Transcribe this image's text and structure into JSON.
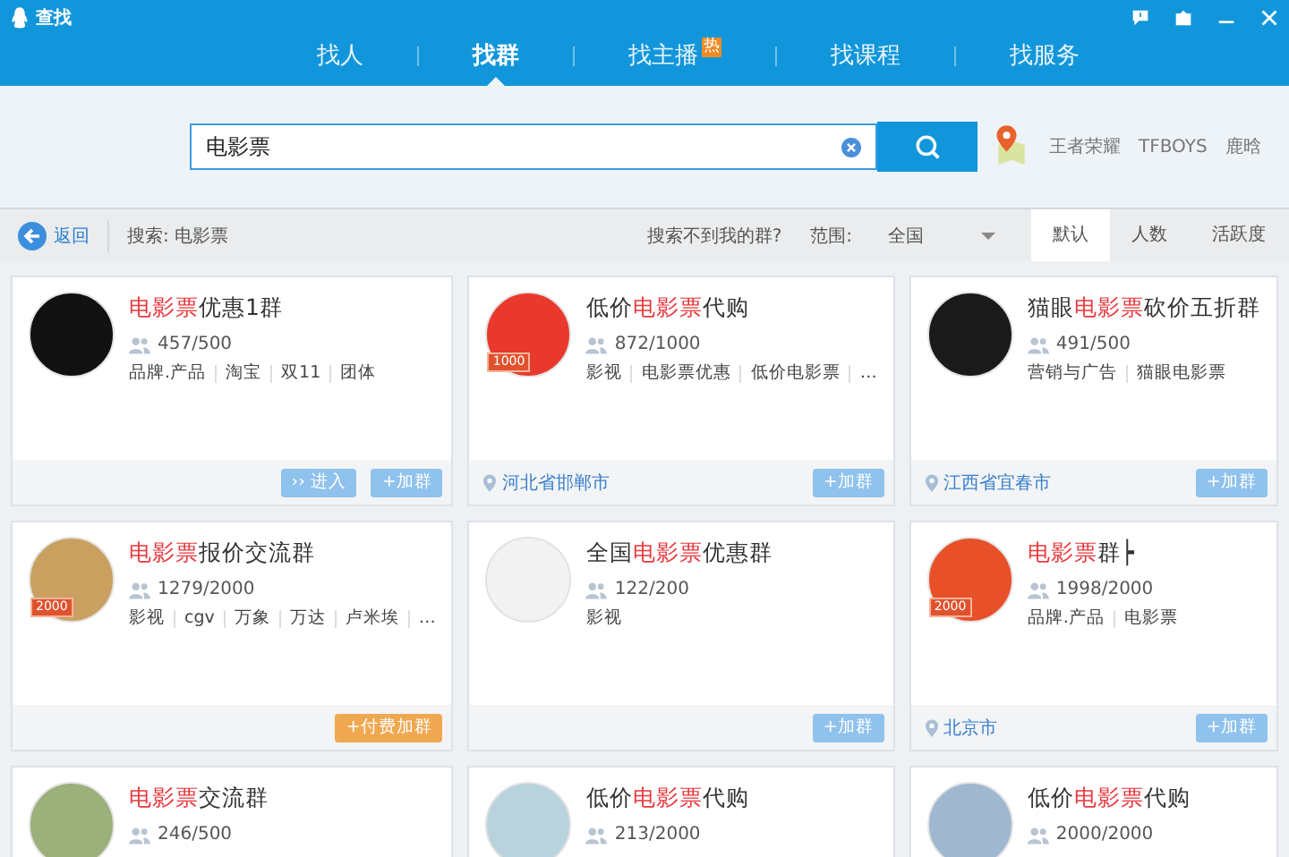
{
  "window": {
    "title": "查找"
  },
  "tabs": [
    {
      "label": "找人",
      "selected": false
    },
    {
      "label": "找群",
      "selected": true
    },
    {
      "label": "找主播",
      "selected": false,
      "badge": "热"
    },
    {
      "label": "找课程",
      "selected": false
    },
    {
      "label": "找服务",
      "selected": false
    }
  ],
  "search": {
    "value": "电影票",
    "hot_words": [
      "王者荣耀",
      "TFBOYS",
      "鹿晗"
    ]
  },
  "toolbar": {
    "back": "返回",
    "query": "搜索: 电影票",
    "help_link": "搜索不到我的群?",
    "range_label": "范围:",
    "range_value": "全国",
    "sorts": [
      {
        "label": "默认",
        "selected": true
      },
      {
        "label": "人数",
        "selected": false
      },
      {
        "label": "活跃度",
        "selected": false
      }
    ]
  },
  "groups": [
    {
      "name": [
        {
          "text": "电影票",
          "highlight": true
        },
        {
          "text": "优惠1群",
          "highlight": false
        }
      ],
      "members": "457/500",
      "tags": [
        "品牌.产品",
        "淘宝",
        "双11",
        "团体"
      ],
      "buttons": [
        {
          "kind": "enter",
          "label": "›› 进入"
        },
        {
          "kind": "join",
          "label": "+加群"
        }
      ]
    },
    {
      "name": [
        {
          "text": "低价",
          "highlight": false
        },
        {
          "text": "电影票",
          "highlight": true
        },
        {
          "text": "代购",
          "highlight": false
        }
      ],
      "badge": "1000",
      "members": "872/1000",
      "tags": [
        "影视",
        "电影票优惠",
        "低价电影票",
        "…"
      ],
      "location": "河北省邯郸市",
      "buttons": [
        {
          "kind": "join",
          "label": "+加群"
        }
      ]
    },
    {
      "name": [
        {
          "text": "猫眼",
          "highlight": false
        },
        {
          "text": "电影票",
          "highlight": true
        },
        {
          "text": "砍价五折群",
          "highlight": false
        }
      ],
      "members": "491/500",
      "tags": [
        "营销与广告",
        "猫眼电影票"
      ],
      "location": "江西省宜春市",
      "buttons": [
        {
          "kind": "join",
          "label": "+加群"
        }
      ]
    },
    {
      "name": [
        {
          "text": "电影票",
          "highlight": true
        },
        {
          "text": "报价交流群",
          "highlight": false
        }
      ],
      "badge": "2000",
      "members": "1279/2000",
      "tags": [
        "影视",
        "cgv",
        "万象",
        "万达",
        "卢米埃",
        "…"
      ],
      "buttons": [
        {
          "kind": "paid",
          "label": "+付费加群"
        }
      ]
    },
    {
      "name": [
        {
          "text": "全国",
          "highlight": false
        },
        {
          "text": "电影票",
          "highlight": true
        },
        {
          "text": "优惠群",
          "highlight": false
        }
      ],
      "members": "122/200",
      "tags": [
        "影视"
      ],
      "buttons": [
        {
          "kind": "join",
          "label": "+加群"
        }
      ]
    },
    {
      "name": [
        {
          "text": "电影票",
          "highlight": true
        },
        {
          "text": "群┝",
          "highlight": false
        }
      ],
      "badge": "2000",
      "members": "1998/2000",
      "tags": [
        "品牌.产品",
        "电影票"
      ],
      "location": "北京市",
      "buttons": [
        {
          "kind": "join",
          "label": "+加群"
        }
      ]
    },
    {
      "name": [
        {
          "text": "电影票",
          "highlight": true
        },
        {
          "text": "交流群",
          "highlight": false
        }
      ],
      "members": "246/500"
    },
    {
      "name": [
        {
          "text": "低价",
          "highlight": false
        },
        {
          "text": "电影票",
          "highlight": true
        },
        {
          "text": "代购",
          "highlight": false
        }
      ],
      "members": "213/2000"
    },
    {
      "name": [
        {
          "text": "低价",
          "highlight": false
        },
        {
          "text": "电影票",
          "highlight": true
        },
        {
          "text": "代购",
          "highlight": false
        }
      ],
      "members": "2000/2000"
    }
  ]
}
